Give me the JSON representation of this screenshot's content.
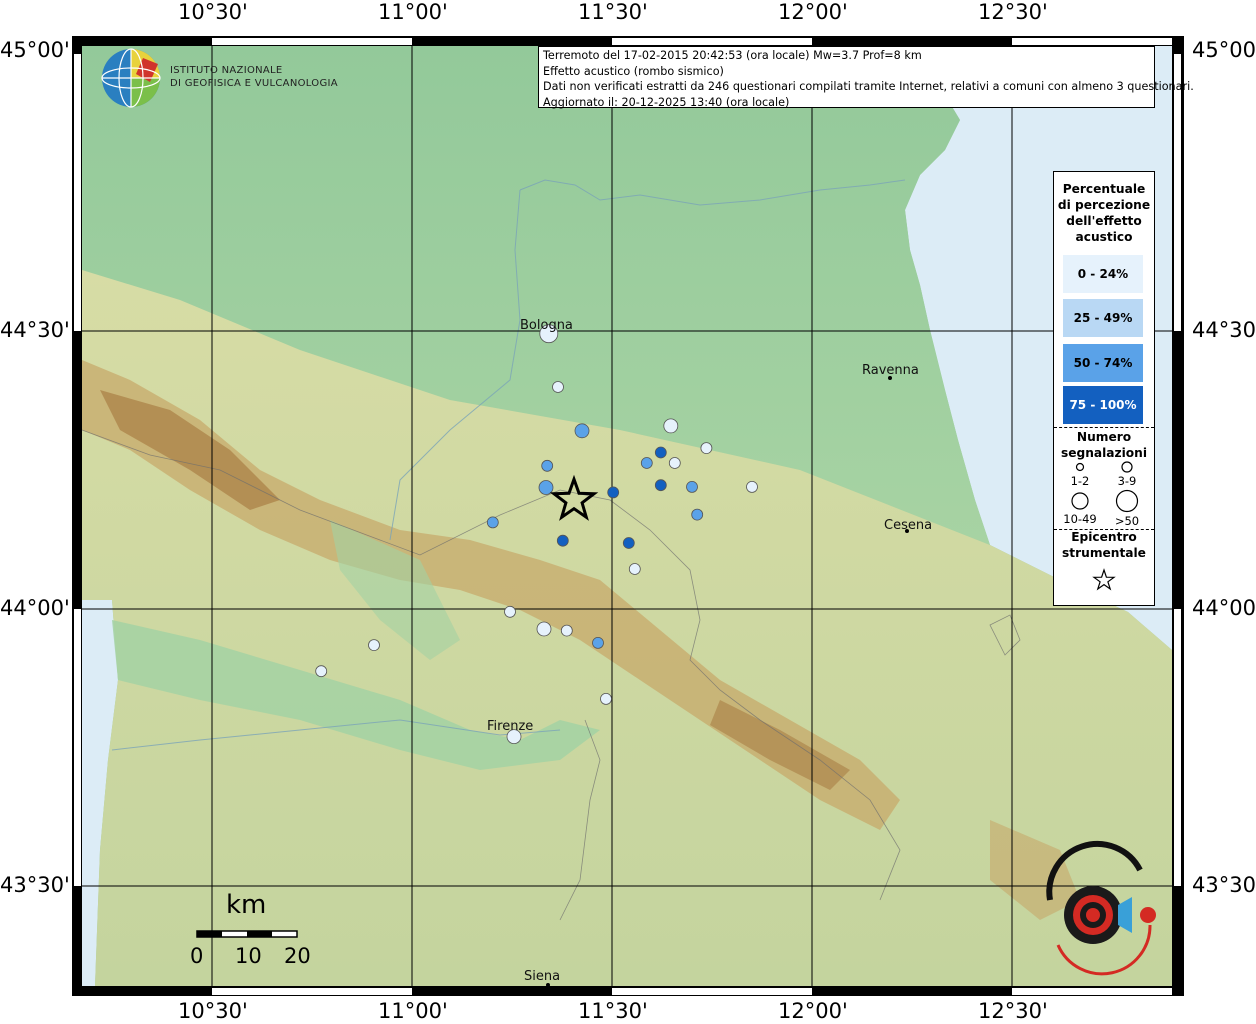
{
  "info": {
    "line1": "Terremoto del 17-02-2015 20:42:53 (ora locale) Mw=3.7 Prof=8 km",
    "line2": "Effetto acustico (rombo sismico)",
    "line3": "Dati non verificati estratti da 246 questionari compilati tramite Internet, relativi a comuni con almeno 3 questionari.",
    "line4": "Aggiornato il: 20-12-2025 13:40 (ora locale)"
  },
  "ingv": {
    "line1": "ISTITUTO NAZIONALE",
    "line2": "DI GEOFISICA E VULCANOLOGIA"
  },
  "axes": {
    "top": [
      "10°30'",
      "11°00'",
      "11°30'",
      "12°00'",
      "12°30'"
    ],
    "bottom": [
      "10°30'",
      "11°00'",
      "11°30'",
      "12°00'",
      "12°30'"
    ],
    "left": [
      "45°00'",
      "44°30'",
      "44°00'",
      "43°30'"
    ],
    "right": [
      "45°00'",
      "44°30'",
      "44°00'",
      "43°30'"
    ]
  },
  "legend": {
    "perc_title": [
      "Percentuale",
      "di percezione",
      "dell'effetto",
      "acustico"
    ],
    "classes": [
      {
        "label": "0 - 24%",
        "color": "#e6f2fc"
      },
      {
        "label": "25 - 49%",
        "color": "#b9d8f4"
      },
      {
        "label": "50 - 74%",
        "color": "#5aa2e8"
      },
      {
        "label": "75 - 100%",
        "color": "#1360c0"
      }
    ],
    "num_title": [
      "Numero",
      "segnalazioni"
    ],
    "sizes": [
      "1-2",
      "3-9",
      "10-49",
      ">50"
    ],
    "epi_title": [
      "Epicentro",
      "strumentale"
    ]
  },
  "cities": [
    "Bologna",
    "Ravenna",
    "Cesena",
    "Firenze",
    "Siena"
  ],
  "scale": {
    "title": "km",
    "ticks": [
      "0",
      "10",
      "20"
    ]
  },
  "epicenter": {
    "lon": 11.405,
    "lat": 44.196
  },
  "observations": [
    {
      "lon": 11.365,
      "lat": 44.4,
      "cls": 0,
      "size": 1
    },
    {
      "lon": 11.342,
      "lat": 44.496,
      "cls": 0,
      "size": 3
    },
    {
      "lon": 11.425,
      "lat": 44.321,
      "cls": 2,
      "size": 2
    },
    {
      "lon": 11.647,
      "lat": 44.33,
      "cls": 0,
      "size": 2
    },
    {
      "lon": 11.622,
      "lat": 44.282,
      "cls": 3,
      "size": 1
    },
    {
      "lon": 11.587,
      "lat": 44.263,
      "cls": 2,
      "size": 1
    },
    {
      "lon": 11.338,
      "lat": 44.258,
      "cls": 2,
      "size": 1
    },
    {
      "lon": 11.736,
      "lat": 44.29,
      "cls": 0,
      "size": 1
    },
    {
      "lon": 11.657,
      "lat": 44.263,
      "cls": 0,
      "size": 1
    },
    {
      "lon": 11.335,
      "lat": 44.219,
      "cls": 2,
      "size": 2
    },
    {
      "lon": 11.503,
      "lat": 44.21,
      "cls": 3,
      "size": 1
    },
    {
      "lon": 11.622,
      "lat": 44.223,
      "cls": 3,
      "size": 1
    },
    {
      "lon": 11.7,
      "lat": 44.22,
      "cls": 2,
      "size": 1
    },
    {
      "lon": 11.85,
      "lat": 44.22,
      "cls": 0,
      "size": 1
    },
    {
      "lon": 11.713,
      "lat": 44.17,
      "cls": 2,
      "size": 1
    },
    {
      "lon": 11.202,
      "lat": 44.156,
      "cls": 2,
      "size": 1
    },
    {
      "lon": 11.377,
      "lat": 44.123,
      "cls": 3,
      "size": 1
    },
    {
      "lon": 11.542,
      "lat": 44.119,
      "cls": 3,
      "size": 1
    },
    {
      "lon": 11.557,
      "lat": 44.072,
      "cls": 0,
      "size": 1
    },
    {
      "lon": 11.245,
      "lat": 43.995,
      "cls": 0,
      "size": 1
    },
    {
      "lon": 11.33,
      "lat": 43.964,
      "cls": 0,
      "size": 2
    },
    {
      "lon": 11.387,
      "lat": 43.961,
      "cls": 0,
      "size": 1
    },
    {
      "lon": 11.465,
      "lat": 43.939,
      "cls": 2,
      "size": 1
    },
    {
      "lon": 10.905,
      "lat": 43.935,
      "cls": 0,
      "size": 1
    },
    {
      "lon": 10.773,
      "lat": 43.888,
      "cls": 0,
      "size": 1
    },
    {
      "lon": 11.485,
      "lat": 43.838,
      "cls": 0,
      "size": 1
    },
    {
      "lon": 11.255,
      "lat": 43.77,
      "cls": 0,
      "size": 2
    }
  ]
}
